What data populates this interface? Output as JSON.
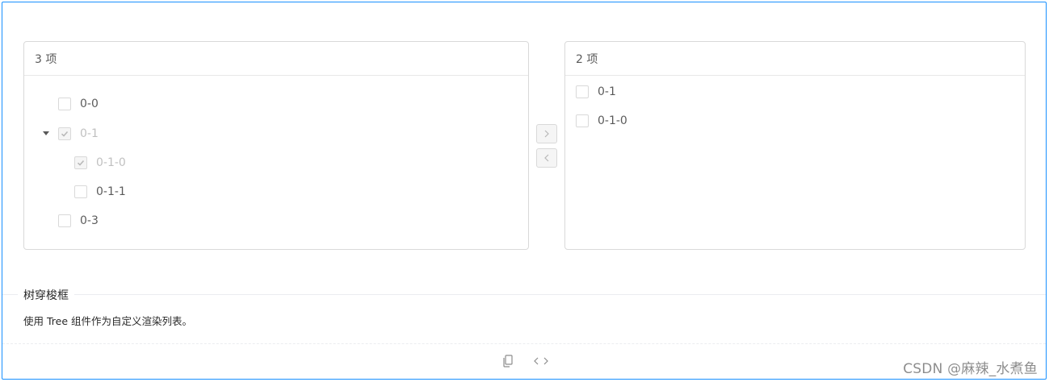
{
  "left_panel": {
    "header": "3 项",
    "tree": [
      {
        "label": "0-0",
        "checked": false,
        "disabled": false
      },
      {
        "label": "0-1",
        "checked": true,
        "disabled": true,
        "expanded": true
      },
      {
        "label": "0-1-0",
        "checked": true,
        "disabled": true
      },
      {
        "label": "0-1-1",
        "checked": false,
        "disabled": false
      },
      {
        "label": "0-3",
        "checked": false,
        "disabled": false
      }
    ]
  },
  "right_panel": {
    "header": "2 项",
    "items": [
      {
        "label": "0-1"
      },
      {
        "label": "0-1-0"
      }
    ]
  },
  "operations": {
    "move_right_icon": "right-arrow-icon",
    "move_left_icon": "left-arrow-icon"
  },
  "demo": {
    "title": "树穿梭框",
    "description": "使用 Tree 组件作为自定义渲染列表。"
  },
  "actions": {
    "copy_icon": "copy-icon",
    "code_icon": "code-expand-icon"
  },
  "watermark": "CSDN @麻辣_水煮鱼",
  "colors": {
    "border_accent": "#1890ff",
    "panel_border": "#d9d9d9"
  }
}
